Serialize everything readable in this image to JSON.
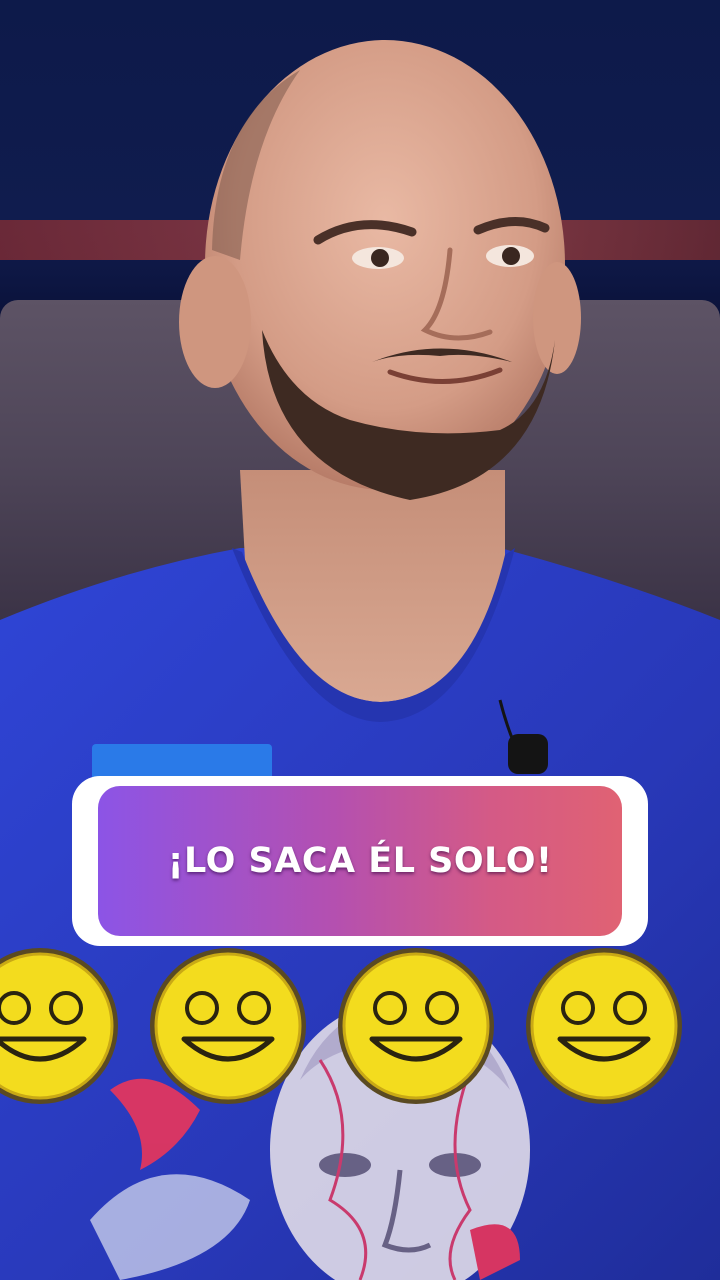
{
  "caption": {
    "text": "¡LO SACA ÉL SOLO!"
  },
  "emojis": [
    {
      "icon": "grinning-face-icon"
    },
    {
      "icon": "grinning-face-icon"
    },
    {
      "icon": "grinning-face-icon"
    },
    {
      "icon": "grinning-face-icon"
    }
  ],
  "colors": {
    "caption_gradient_start": "#8c54e6",
    "caption_gradient_end": "#e06273",
    "caption_border": "#ffffff",
    "shirt_blue": "#2b3fc9",
    "emoji_yellow": "#f3dc1e"
  }
}
